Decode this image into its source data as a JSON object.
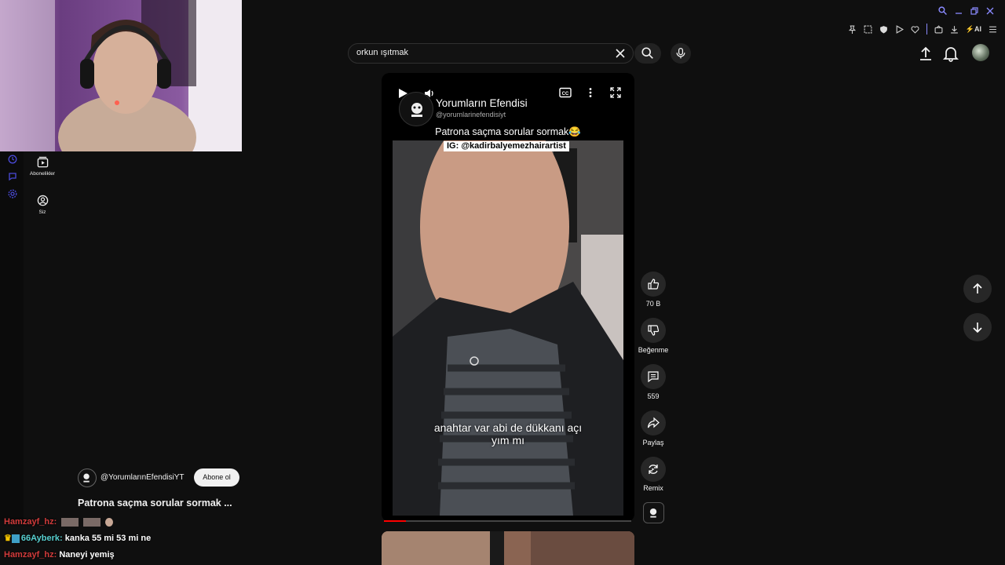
{
  "search": {
    "query": "orkun ışıtmak"
  },
  "browser": {
    "ai_label": "AI"
  },
  "sidebar": {
    "items": [
      {
        "label": "Abonelikler",
        "icon": "subscriptions-icon"
      },
      {
        "label": "Siz",
        "icon": "you-icon"
      }
    ]
  },
  "video": {
    "channel_name": "Yorumların Efendisi",
    "channel_handle": "@yorumlarinefendisiyt",
    "caption_title": "Patrona saçma sorular sormak😂",
    "ig_tag": "IG: @kadirbalyemezhairartist",
    "subtitle_line1": "anahtar var abi de dükkanı açı",
    "subtitle_line2": "yım mı",
    "progress_fraction": 0.09
  },
  "actions": {
    "like_count": "70 B",
    "dislike_label": "Beğenme",
    "comment_count": "559",
    "share_label": "Paylaş",
    "remix_label": "Remix"
  },
  "info": {
    "channel": "@YorumlarınEfendisiYT",
    "subscribe_label": "Abone ol",
    "title": "Patrona saçma sorular sormak ..."
  },
  "chat": [
    {
      "user": "Hamzayf_hz:",
      "message": ""
    },
    {
      "user": "66Ayberk:",
      "message": "kanka 55 mi 53 mi ne"
    },
    {
      "user": "Hamzayf_hz:",
      "message": "Naneyi yemiş"
    }
  ],
  "colors": {
    "accent": "#ff0000",
    "browser_accent": "#8a8aff"
  }
}
